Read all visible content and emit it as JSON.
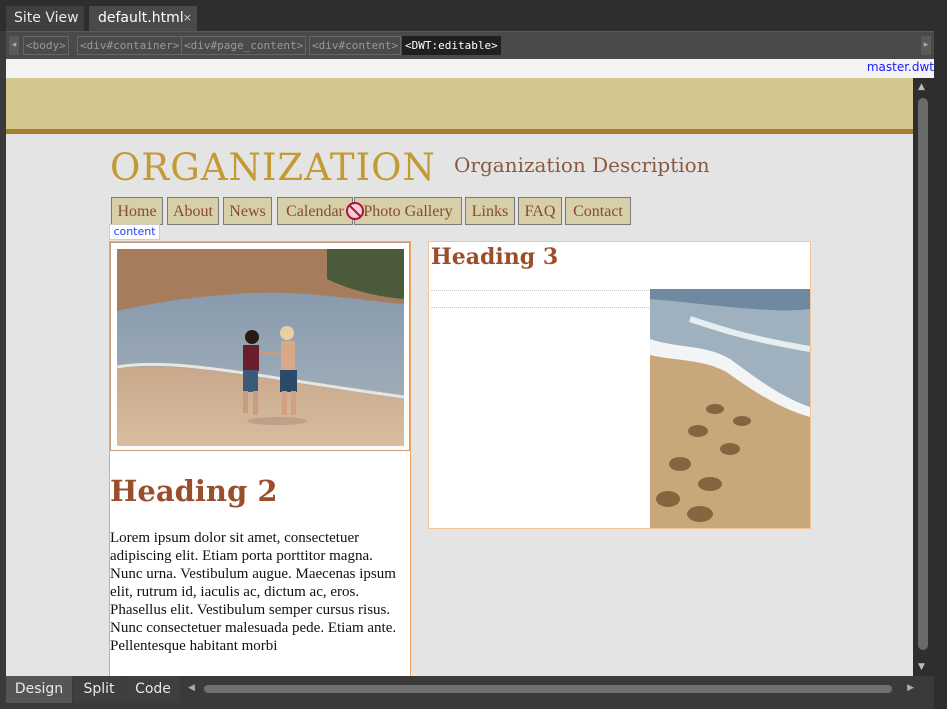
{
  "tabs": {
    "site_view": "Site View",
    "file": "default.html",
    "close_glyph": "×"
  },
  "breadcrumbs": [
    "<body>",
    "<div#container>",
    "<div#page_content>",
    "<div#content>",
    "<DWT:editable>"
  ],
  "template_link": "master.dwt",
  "page": {
    "org_title": "ORGANIZATION",
    "org_description": "Organization Description",
    "nav": [
      "Home",
      "About",
      "News",
      "Calendar",
      "Photo Gallery",
      "Links",
      "FAQ",
      "Contact"
    ],
    "region_label": "content",
    "heading2": "Heading 2",
    "heading3": "Heading 3",
    "lorem": "Lorem ipsum dolor sit amet, consectetuer adipiscing elit. Etiam porta porttitor magna. Nunc urna. Vestibulum augue. Maecenas ipsum elit, rutrum id, iaculis ac, dictum ac, eros. Phasellus elit. Vestibulum semper cursus risus. Nunc consectetuer malesuada pede. Etiam ante. Pellentesque habitant morbi"
  },
  "view_buttons": {
    "design": "Design",
    "split": "Split",
    "code": "Code"
  },
  "icons": {
    "no_entry": "not-allowed-icon",
    "scroll_up": "arrow-up-icon",
    "scroll_down": "arrow-down-icon",
    "scroll_left": "arrow-left-icon",
    "scroll_right": "arrow-right-icon"
  },
  "colors": {
    "band": "#d2c78f",
    "band_line": "#a47f2e",
    "title": "#c49a34",
    "heading": "#9a4f2c",
    "nav_bg": "#d6cfa8",
    "link": "#1a1aff"
  }
}
